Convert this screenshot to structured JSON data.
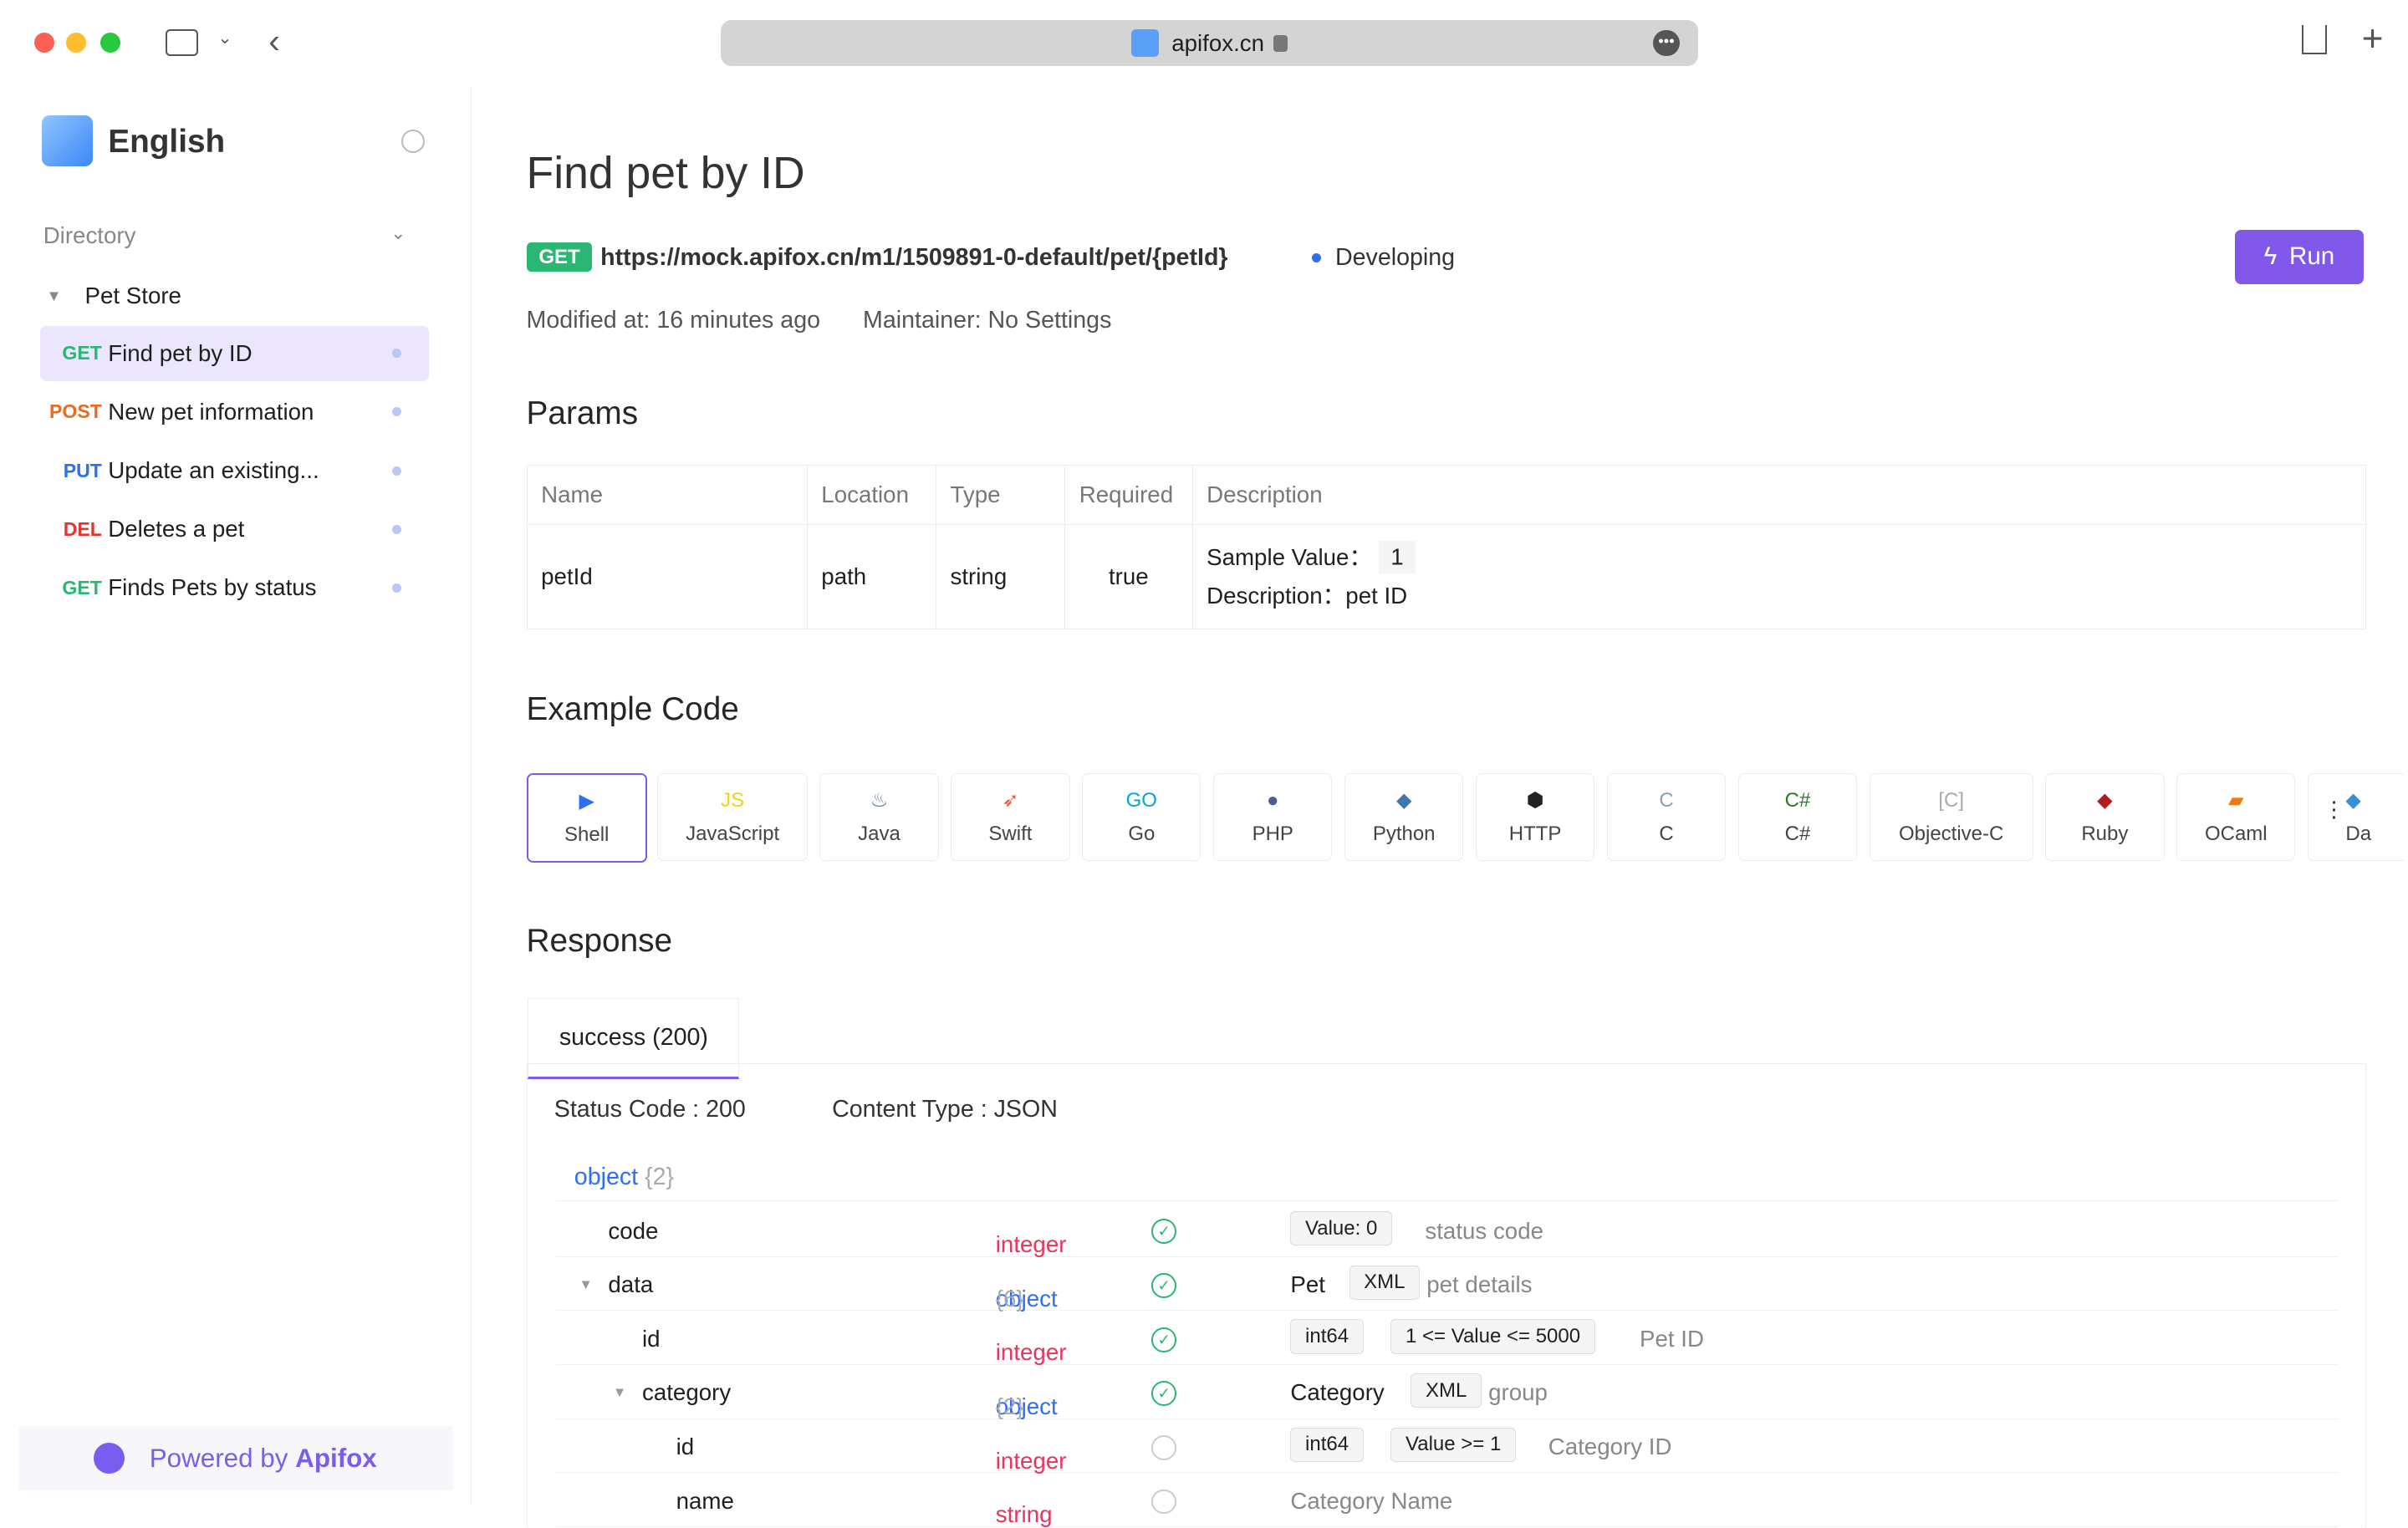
{
  "browser": {
    "url": "apifox.cn"
  },
  "sidebar": {
    "title": "English",
    "directory": "Directory",
    "folder": "Pet Store",
    "items": [
      {
        "method": "GET",
        "label": "Find pet by ID",
        "color": "#2bb673"
      },
      {
        "method": "POST",
        "label": "New pet information",
        "color": "#ea6a1f"
      },
      {
        "method": "PUT",
        "label": "Update an existing...",
        "color": "#2e6df5"
      },
      {
        "method": "DEL",
        "label": "Deletes a pet",
        "color": "#e8342e"
      },
      {
        "method": "GET",
        "label": "Finds Pets by status",
        "color": "#2bb673"
      }
    ],
    "powered": "Powered by",
    "brand": "Apifox"
  },
  "main": {
    "title": "Find pet by ID",
    "method": "GET",
    "url": "https://mock.apifox.cn/m1/1509891-0-default/pet/{petId}",
    "status": "Developing",
    "run": "Run",
    "modified": "Modified at: 16 minutes ago",
    "maintainer": "Maintainer: No Settings",
    "params_title": "Params",
    "params_headers": [
      "Name",
      "Location",
      "Type",
      "Required",
      "Description"
    ],
    "param": {
      "name": "petId",
      "location": "path",
      "type": "string",
      "required": "true",
      "sample_label": "Sample Value：",
      "sample": "1",
      "desc_label": "Description：",
      "desc": "pet ID"
    },
    "example_title": "Example Code",
    "langs": [
      "Shell",
      "JavaScript",
      "Java",
      "Swift",
      "Go",
      "PHP",
      "Python",
      "HTTP",
      "C",
      "C#",
      "Objective-C",
      "Ruby",
      "OCaml",
      "Da"
    ],
    "response_title": "Response",
    "resp_tab": "success (200)",
    "status_code": "Status Code : 200",
    "content_type": "Content Type : JSON",
    "root": "object",
    "root_count": "{2}",
    "rows": [
      {
        "name": "code",
        "type": "integer",
        "req": true,
        "tags": [
          "Value: 0"
        ],
        "desc": "status code"
      },
      {
        "name": "data",
        "type": "object",
        "count": "{6}",
        "req": true,
        "pre": "Pet",
        "tags": [
          "XML"
        ],
        "desc": "pet details"
      },
      {
        "name": "id",
        "type": "integer",
        "req": true,
        "tags": [
          "int64",
          "1 <= Value <= 5000"
        ],
        "desc": "Pet ID"
      },
      {
        "name": "category",
        "type": "object",
        "count": "{2}",
        "req": true,
        "pre": "Category",
        "tags": [
          "XML"
        ],
        "desc": "group"
      },
      {
        "name": "id",
        "type": "integer",
        "req": false,
        "tags": [
          "int64",
          "Value >= 1"
        ],
        "desc": "Category ID"
      },
      {
        "name": "name",
        "type": "string",
        "req": false,
        "tags": [],
        "desc": "Category Name"
      }
    ]
  }
}
